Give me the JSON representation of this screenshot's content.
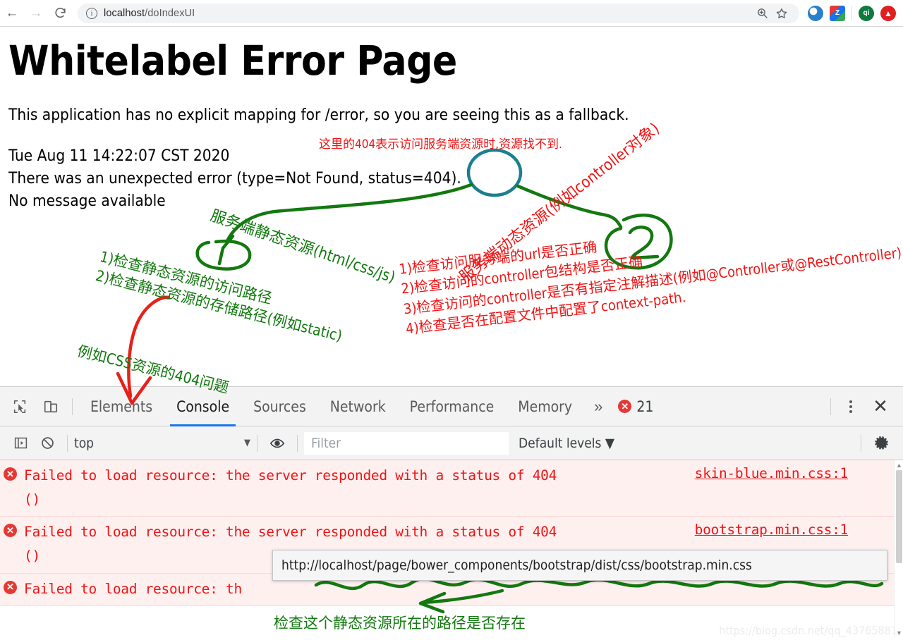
{
  "browser": {
    "back_icon": "arrow-left-icon",
    "forward_icon": "arrow-right-icon",
    "reload_icon": "reload-icon",
    "info_icon": "info-circle-icon",
    "url_host": "localhost",
    "url_path": "/doIndexUI",
    "url_full": "localhost/doIndexUI",
    "zoom_icon": "zoom-in-icon",
    "bookmark_icon": "star-icon",
    "extensions": [
      {
        "name": "extension-blue-circle",
        "label": "",
        "color": "#2a7fc9"
      },
      {
        "name": "extension-colorful-z",
        "label": "Z",
        "color": "#e53935"
      },
      {
        "name": "extension-qi",
        "label": "qi",
        "color": "#0d7a3f"
      },
      {
        "name": "extension-red-arrow",
        "label": "⬆",
        "color": "#e02020"
      }
    ]
  },
  "page": {
    "title": "Whitelabel Error Page",
    "intro": "This application has no explicit mapping for /error, so you are seeing this as a fallback.",
    "timestamp": "Tue Aug 11 14:22:07 CST 2020",
    "error_line": "There was an unexpected error (type=Not Found, status=404).",
    "message_line": "No message available"
  },
  "annotations": {
    "red_top": "这里的404表示访问服务端资源时,资源找不到.",
    "green_static": "服务端静态资源(html/css/js)",
    "red_dynamic": "服务端动态资源(例如controller对象)",
    "green_check_1": "1)检查静态资源的访问路径",
    "green_check_2": "2)检查静态资源的存储路径(例如static)",
    "green_css_404": "例如CSS资源的404问题",
    "red_list": [
      "1)检查访问服务端的url是否正确",
      "2)检查访问的controller包结构是否正确",
      "3)检查访问的controller是否有指定注解描述(例如@Controller或@RestController)",
      "4)检查是否在配置文件中配置了context-path."
    ],
    "green_bottom": "检查这个静态资源所在的路径是否存在",
    "marker_one": "1",
    "marker_two": "2",
    "colors": {
      "red": "#f01414",
      "green": "#12790f",
      "teal": "#1a7f8e"
    }
  },
  "devtools": {
    "inspect_icon": "inspect-cursor-icon",
    "device_icon": "device-toolbar-icon",
    "tabs": [
      {
        "label": "Elements",
        "active": false
      },
      {
        "label": "Console",
        "active": true
      },
      {
        "label": "Sources",
        "active": false
      },
      {
        "label": "Network",
        "active": false
      },
      {
        "label": "Performance",
        "active": false
      },
      {
        "label": "Memory",
        "active": false
      }
    ],
    "more_tabs_icon": "chevron-double-right-icon",
    "error_count": "21",
    "error_badge_icon": "error-circle-icon",
    "menu_icon": "kebab-menu-icon",
    "close_icon": "close-icon",
    "filterbar": {
      "sidebar_icon": "console-sidebar-icon",
      "clear_icon": "clear-console-icon",
      "context": "top",
      "context_caret": "▼",
      "eye_icon": "live-expression-eye-icon",
      "filter_placeholder": "Filter",
      "filter_value": "",
      "levels_label": "Default levels",
      "levels_caret": "▼",
      "settings_icon": "gear-icon"
    },
    "console_rows": [
      {
        "icon": "error-circle-icon",
        "message": "Failed to load resource: the server responded with a status of 404",
        "message_second_line": "()",
        "source": "skin-blue.min.css:1"
      },
      {
        "icon": "error-circle-icon",
        "message": "Failed to load resource: the server responded with a status of 404",
        "message_second_line": "()",
        "source": "bootstrap.min.css:1"
      },
      {
        "icon": "error-circle-icon",
        "message": "Failed to load resource: th",
        "message_second_line": "",
        "source": ""
      }
    ],
    "tooltip_url": "http://localhost/page/bower_components/bootstrap/dist/css/bootstrap.min.css"
  },
  "watermark": "https://blog.csdn.net/qq_43765881"
}
